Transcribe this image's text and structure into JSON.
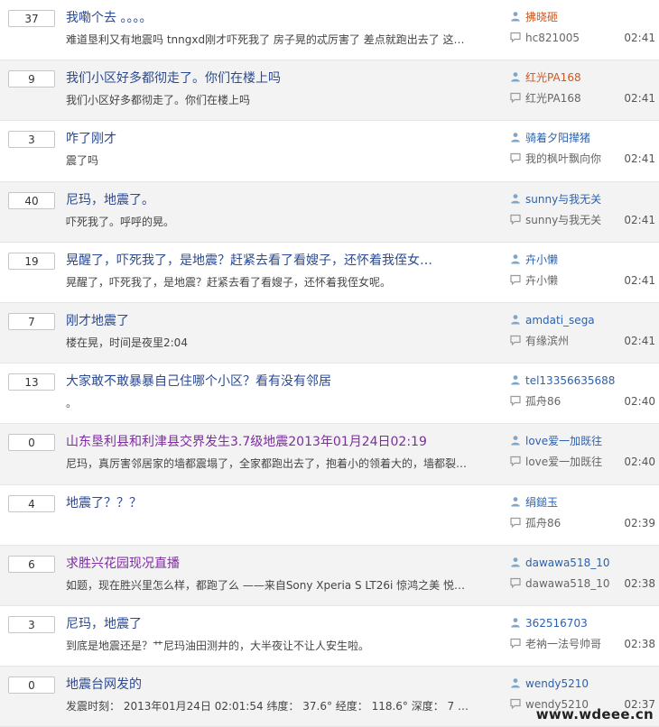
{
  "threads": [
    {
      "replies": "37",
      "title": "我嘞个去 。。。。",
      "preview": "难道垦利又有地震吗 tnngxd刚才吓死我了 房子晃的忒厉害了 差点就跑出去了 这是…",
      "author": "拂晓砸",
      "last_replier": "hc821005",
      "time": "02:41",
      "visited": false,
      "author_color": "orange"
    },
    {
      "replies": "9",
      "title": "我们小区好多都彻走了。你们在楼上吗",
      "preview": "我们小区好多都彻走了。你们在楼上吗",
      "author": "红光PA168",
      "last_replier": "红光PA168",
      "time": "02:41",
      "visited": false,
      "author_color": "orange"
    },
    {
      "replies": "3",
      "title": "咋了刚才",
      "preview": "震了吗",
      "author": "骑着夕阳撵猪",
      "last_replier": "我的枫叶飘向你",
      "time": "02:41",
      "visited": false,
      "author_color": "blue"
    },
    {
      "replies": "40",
      "title": "尼玛，地震了。",
      "preview": "吓死我了。呼呼的晃。",
      "author": "sunny与我无关",
      "last_replier": "sunny与我无关",
      "time": "02:41",
      "visited": false,
      "author_color": "blue"
    },
    {
      "replies": "19",
      "title": "晃醒了，吓死我了，是地震？赶紧去看了看嫂子，还怀着我侄女…",
      "preview": "晃醒了，吓死我了，是地震？赶紧去看了看嫂子，还怀着我侄女呢。",
      "author": "卉小懒",
      "last_replier": "卉小懒",
      "time": "02:41",
      "visited": false,
      "author_color": "blue"
    },
    {
      "replies": "7",
      "title": "刚才地震了",
      "preview": "楼在晃，时间是夜里2:04",
      "author": "amdati_sega",
      "last_replier": "有缘滨州",
      "time": "02:41",
      "visited": false,
      "author_color": "blue"
    },
    {
      "replies": "13",
      "title": "大家敢不敢暴暴自己住哪个小区？看有没有邻居",
      "preview": "。",
      "author": "tel13356635688",
      "last_replier": "孤舟86",
      "time": "02:40",
      "visited": false,
      "author_color": "blue"
    },
    {
      "replies": "0",
      "title": "山东垦利县和利津县交界发生3.7级地震2013年01月24日02:19",
      "preview": "尼玛，真厉害邻居家的墙都震塌了，全家都跑出去了，抱着小的领着大的，墙都裂…",
      "author": "love爱一加既往",
      "last_replier": "love爱一加既往",
      "time": "02:40",
      "visited": true,
      "author_color": "blue"
    },
    {
      "replies": "4",
      "title": "地震了？？？",
      "preview": "",
      "author": "绢鎚玉",
      "last_replier": "孤舟86",
      "time": "02:39",
      "visited": false,
      "author_color": "blue"
    },
    {
      "replies": "6",
      "title": "求胜兴花园现况直播",
      "preview": "如题，现在胜兴里怎么样，都跑了么 ——来自Sony Xperia S LT26i 惊鸿之美 悦动…",
      "author": "dawawa518_10",
      "last_replier": "dawawa518_10",
      "time": "02:38",
      "visited": true,
      "author_color": "blue"
    },
    {
      "replies": "3",
      "title": "尼玛，地震了",
      "preview": "到底是地震还是？艹尼玛油田测井的，大半夜让不让人安生啦。",
      "author": "362516703",
      "last_replier": "老衲一法号帅哥",
      "time": "02:38",
      "visited": false,
      "author_color": "blue"
    },
    {
      "replies": "0",
      "title": "地震台网发的",
      "preview": "发震时刻： 2013年01月24日 02:01:54 纬度： 37.6° 经度： 118.6° 深度： 7 千米…",
      "author": "wendy5210",
      "last_replier": "wendy5210",
      "time": "02:37",
      "visited": false,
      "author_color": "blue"
    }
  ],
  "watermark": "www.wdeee.cn",
  "colors": {
    "title": "#2b4a94",
    "visited_title": "#7c2d9e",
    "author": "#2b62b0",
    "author_orange": "#d1561b",
    "row_alt": "#f3f3f3"
  },
  "icons": {
    "author": "user-icon",
    "last_replier": "reply-icon"
  }
}
